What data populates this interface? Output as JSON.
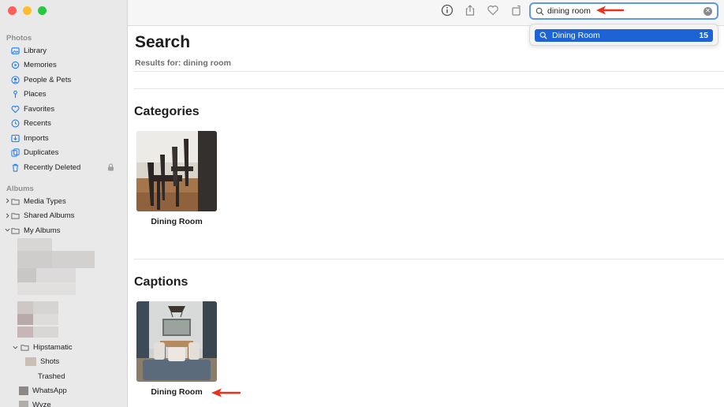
{
  "sidebar": {
    "photos_header": "Photos",
    "albums_header": "Albums",
    "items": [
      {
        "label": "Library",
        "icon": "library-icon"
      },
      {
        "label": "Memories",
        "icon": "memories-icon"
      },
      {
        "label": "People & Pets",
        "icon": "people-icon"
      },
      {
        "label": "Places",
        "icon": "places-icon"
      },
      {
        "label": "Favorites",
        "icon": "heart-icon"
      },
      {
        "label": "Recents",
        "icon": "clock-icon"
      },
      {
        "label": "Imports",
        "icon": "imports-icon"
      },
      {
        "label": "Duplicates",
        "icon": "duplicates-icon"
      },
      {
        "label": "Recently Deleted",
        "icon": "trash-icon"
      }
    ],
    "album_groups": [
      {
        "label": "Media Types"
      },
      {
        "label": "Shared Albums"
      },
      {
        "label": "My Albums"
      }
    ],
    "sub_albums": [
      {
        "label": "Hipstamatic"
      },
      {
        "label": "Shots"
      },
      {
        "label": "Trashed"
      },
      {
        "label": "WhatsApp"
      },
      {
        "label": "Wyze"
      }
    ]
  },
  "search": {
    "value": "dining room",
    "suggestion_label": "Dining Room",
    "suggestion_count": "15"
  },
  "main": {
    "title": "Search",
    "results_for": "Results for: dining room",
    "categories_heading": "Categories",
    "captions_heading": "Captions",
    "category_item_label": "Dining Room",
    "caption_item_label": "Dining Room"
  },
  "colors": {
    "accent": "#1d63d6",
    "annotation_arrow": "#e8321e",
    "sidebar_bg": "#e9e9ea"
  }
}
